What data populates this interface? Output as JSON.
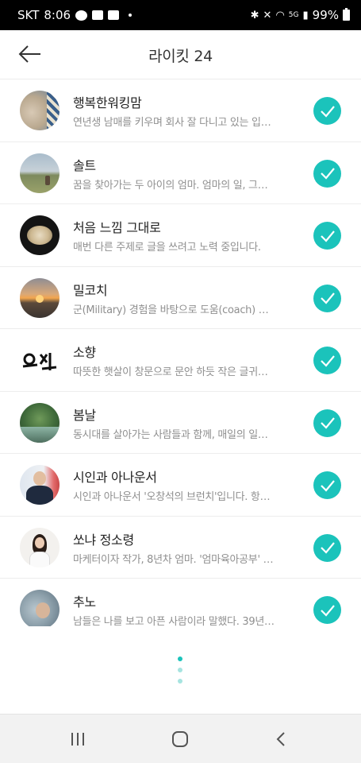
{
  "status_bar": {
    "carrier": "SKT",
    "time": "8:06",
    "network": "5G",
    "battery": "99%",
    "icons": [
      "chat-icon",
      "image-icon",
      "youtube-icon",
      "bluetooth-icon",
      "mute-icon",
      "wifi-icon",
      "signal-icon",
      "battery-icon"
    ]
  },
  "header": {
    "title": "라이킷 24",
    "back_icon": "arrow-left-icon"
  },
  "colors": {
    "accent": "#1bc3bb",
    "pager_inactive": "#a6e4e0"
  },
  "users": [
    {
      "name": "행복한워킹맘",
      "desc": "연년생 남매를 키우며 회사 잘 다니고 있는 입…",
      "liked": true
    },
    {
      "name": "솔트",
      "desc": "꿈을 찾아가는 두 아이의 엄마. 엄마의 일, 그…",
      "liked": true
    },
    {
      "name": "처음 느낌 그대로",
      "desc": "매번 다른 주제로 글을 쓰려고 노력 중입니다.",
      "liked": true
    },
    {
      "name": "밀코치",
      "desc": "군(Military) 경험을 바탕으로 도움(coach) …",
      "liked": true
    },
    {
      "name": "소향",
      "desc": "따뜻한 햇살이 창문으로 문안 하듯 작은 글귀…",
      "liked": true
    },
    {
      "name": "봄날",
      "desc": "동시대를 살아가는 사람들과 함께, 매일의 일…",
      "liked": true
    },
    {
      "name": "시인과 아나운서",
      "desc": "시인과 아나운서 '오창석의 브런치'입니다. 항…",
      "liked": true
    },
    {
      "name": "쏘냐 정소령",
      "desc": "마케터이자 작가, 8년차 엄마. '엄마육아공부' …",
      "liked": true
    },
    {
      "name": "추노",
      "desc": "남들은 나를 보고 아픈 사람이라 말했다. 39년…",
      "liked": true
    }
  ],
  "pager": {
    "count": 3,
    "active": 0
  },
  "nav_bar": {
    "icons": [
      "recent-apps-icon",
      "home-icon",
      "back-icon"
    ]
  }
}
